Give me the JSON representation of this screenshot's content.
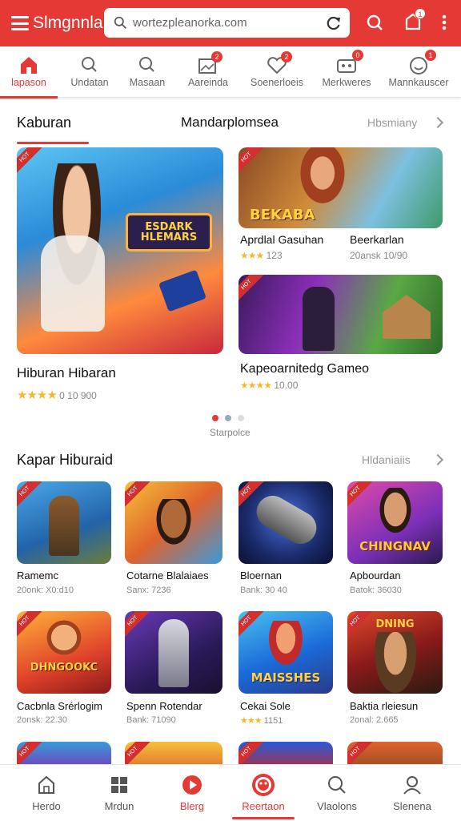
{
  "app": {
    "title": "Slmgnnla"
  },
  "search": {
    "value": "wortezpleanorka.com"
  },
  "categories": [
    {
      "label": "lapason",
      "icon": "home-icon",
      "badge": ""
    },
    {
      "label": "Undatan",
      "icon": "search-icon",
      "badge": ""
    },
    {
      "label": "Masaan",
      "icon": "search-icon",
      "badge": ""
    },
    {
      "label": "Aareinda",
      "icon": "image-icon",
      "badge": "2"
    },
    {
      "label": "Soenerloeis",
      "icon": "heart-icon",
      "badge": "2"
    },
    {
      "label": "Merkweres",
      "icon": "controller-icon",
      "badge": "0"
    },
    {
      "label": "Mannkauscer",
      "icon": "smile-icon",
      "badge": "1"
    }
  ],
  "section1": {
    "tab_active": "Kaburan",
    "tab_other": "Mandarplomsea",
    "more": "Hbsmiany",
    "featured": {
      "art_text": "ESDARK HLEMARS",
      "title": "Hiburan Hibaran",
      "rating_text": "0 10 900"
    },
    "side_cards": [
      {
        "art_text": "BEKABA",
        "title_left": "Aprdlal Gasuhan",
        "title_right": "Beerkarlan",
        "meta_left": "123",
        "meta_right": "20ansk 10/90"
      },
      {
        "art_text": "",
        "title_left": "Kapeoarnitedg Gameo",
        "title_right": "",
        "meta_left": "10.00",
        "meta_right": ""
      }
    ],
    "carousel_label": "Starpolce"
  },
  "section2": {
    "title": "Kapar Hiburaid",
    "more": "Hldaniaiis",
    "games": [
      {
        "title": "Ramemc",
        "meta": "20onk: X0:d10",
        "art_text": ""
      },
      {
        "title": "Cotarne Blalaiaes",
        "meta": "Sanx: 7236",
        "art_text": ""
      },
      {
        "title": "Bloernan",
        "meta": "Bank: 30 40",
        "art_text": ""
      },
      {
        "title": "Apbourdan",
        "meta": "Batok: 36030",
        "art_text": "CHINGNAV"
      },
      {
        "title": "Cacbnla Srérlogim",
        "meta": "2onsk: 22.30",
        "art_text": "DHNGOOKC"
      },
      {
        "title": "Spenn Rotendar",
        "meta": "Bank: 71090",
        "art_text": ""
      },
      {
        "title": "Cekai Sole",
        "meta": "1151",
        "art_text": "MAISSHES"
      },
      {
        "title": "Baktia rleiesun",
        "meta": "2onal: 2.665",
        "art_text": "DNING"
      }
    ]
  },
  "bottom_nav": [
    {
      "label": "Herdo",
      "icon": "home-icon"
    },
    {
      "label": "Mrdun",
      "icon": "grid-icon"
    },
    {
      "label": "Blerg",
      "icon": "play-icon"
    },
    {
      "label": "Reertaon",
      "icon": "game-badge-icon"
    },
    {
      "label": "Vlaolons",
      "icon": "search-icon"
    },
    {
      "label": "Slenena",
      "icon": "user-icon"
    }
  ],
  "colors": {
    "accent": "#e53935",
    "star": "#f5b82e"
  }
}
